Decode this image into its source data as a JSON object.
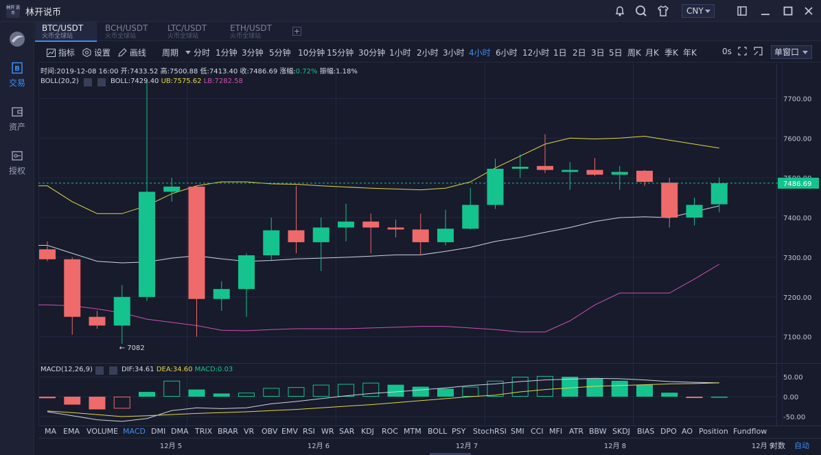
{
  "app": {
    "logo_text": "林开 说币",
    "title": "林开说币"
  },
  "titlebar": {
    "icons": [
      "bell-icon",
      "search-icon",
      "shirt-icon",
      "popout-icon",
      "minimize-icon",
      "maximize-icon",
      "close-icon"
    ],
    "currency": "CNY"
  },
  "sidebar": {
    "items": [
      {
        "name": "logo",
        "label": ""
      },
      {
        "name": "trade",
        "label": "交易",
        "icon": "B"
      },
      {
        "name": "assets",
        "label": "资产",
        "icon": "▭"
      },
      {
        "name": "auth",
        "label": "授权",
        "icon": "⚿"
      }
    ]
  },
  "pair_tabs": [
    {
      "pair": "BTC/USDT",
      "exchange": "火币全球站"
    },
    {
      "pair": "BCH/USDT",
      "exchange": "火币全球站"
    },
    {
      "pair": "LTC/USDT",
      "exchange": "火币全球站"
    },
    {
      "pair": "ETH/USDT",
      "exchange": "火币全球站"
    }
  ],
  "add_tab_label": "+",
  "toolbar": {
    "indicator": "指标",
    "settings": "设置",
    "draw": "画线",
    "period_label": "周期",
    "periods": [
      "分时",
      "1分钟",
      "3分钟",
      "5分钟",
      "10分钟",
      "15分钟",
      "30分钟",
      "1小时",
      "2小时",
      "3小时",
      "4小时",
      "6小时",
      "12小时",
      "1日",
      "2日",
      "3日",
      "5日",
      "周K",
      "月K",
      "季K",
      "年K"
    ],
    "active_period": "4小时",
    "countdown": "0s",
    "layout": "单窗口"
  },
  "ohlc_info": {
    "time_label": "时间:",
    "time": "2019-12-08 16:00",
    "open_label": "开:",
    "open": "7433.52",
    "high_label": "高:",
    "high": "7500.88",
    "low_label": "低:",
    "low": "7413.40",
    "close_label": "收:",
    "close": "7486.69",
    "change_label": "涨幅:",
    "change": "0.72%",
    "amplitude_label": "振幅:",
    "amplitude": "1.18%"
  },
  "boll_info": {
    "name": "BOLL(20,2)",
    "mid": "BOLL:7429.40",
    "ub": "UB:7575.62",
    "lb": "LB:7282.58"
  },
  "macd_info": {
    "name": "MACD(12,26,9)",
    "dif": "DIF:34.61",
    "dea": "DEA:34.60",
    "macd": "MACD:0.03"
  },
  "price_axis": [
    "7700.00",
    "7600.00",
    "7500.00",
    "7400.00",
    "7300.00",
    "7200.00",
    "7100.00"
  ],
  "current_price": "7486.69",
  "low_marker": "7082",
  "macd_axis": [
    "50.00",
    "0.00",
    "-50.00"
  ],
  "indicator_tabs": [
    "MA",
    "EMA",
    "VOLUME",
    "MACD",
    "DMI",
    "DMA",
    "TRIX",
    "BRAR",
    "VR",
    "OBV",
    "EMV",
    "RSI",
    "WR",
    "SAR",
    "KDJ",
    "ROC",
    "MTM",
    "BOLL",
    "PSY",
    "StochRSI",
    "SMI",
    "CCI",
    "MFI",
    "ATR",
    "BBW",
    "SKDJ",
    "BIAS",
    "DPO",
    "AO",
    "Position",
    "Fundflow"
  ],
  "active_indicator": "MACD",
  "date_axis": [
    "12月 5",
    "12月 6",
    "12月 7",
    "12月 8",
    "12月 9"
  ],
  "auto_label": "自动",
  "log_label": "对数",
  "colors": {
    "up": "#14c38e",
    "down": "#ef6a6a",
    "accent": "#3d8ef5",
    "ub": "#e6d84a",
    "mid": "#d0d3e3",
    "lb": "#d04fb8",
    "bg": "#171b2b"
  },
  "chart_data": {
    "type": "candlestick",
    "pair": "BTC/USDT",
    "period": "4小时",
    "ylim": [
      7050,
      7750
    ],
    "candles": [
      {
        "o": 7320,
        "h": 7340,
        "l": 7290,
        "c": 7295
      },
      {
        "o": 7295,
        "h": 7300,
        "l": 7105,
        "c": 7150
      },
      {
        "o": 7150,
        "h": 7165,
        "l": 7120,
        "c": 7128
      },
      {
        "o": 7128,
        "h": 7230,
        "l": 7082,
        "c": 7200
      },
      {
        "o": 7200,
        "h": 7745,
        "l": 7190,
        "c": 7465
      },
      {
        "o": 7465,
        "h": 7500,
        "l": 7440,
        "c": 7478
      },
      {
        "o": 7478,
        "h": 7480,
        "l": 7100,
        "c": 7195
      },
      {
        "o": 7195,
        "h": 7240,
        "l": 7165,
        "c": 7220
      },
      {
        "o": 7220,
        "h": 7310,
        "l": 7150,
        "c": 7305
      },
      {
        "o": 7305,
        "h": 7400,
        "l": 7290,
        "c": 7368
      },
      {
        "o": 7368,
        "h": 7480,
        "l": 7310,
        "c": 7338
      },
      {
        "o": 7338,
        "h": 7400,
        "l": 7265,
        "c": 7375
      },
      {
        "o": 7375,
        "h": 7435,
        "l": 7340,
        "c": 7390
      },
      {
        "o": 7390,
        "h": 7410,
        "l": 7310,
        "c": 7375
      },
      {
        "o": 7375,
        "h": 7395,
        "l": 7350,
        "c": 7370
      },
      {
        "o": 7370,
        "h": 7410,
        "l": 7305,
        "c": 7338
      },
      {
        "o": 7338,
        "h": 7420,
        "l": 7330,
        "c": 7372
      },
      {
        "o": 7372,
        "h": 7475,
        "l": 7370,
        "c": 7432
      },
      {
        "o": 7432,
        "h": 7548,
        "l": 7422,
        "c": 7523
      },
      {
        "o": 7523,
        "h": 7560,
        "l": 7500,
        "c": 7528
      },
      {
        "o": 7530,
        "h": 7610,
        "l": 7512,
        "c": 7520
      },
      {
        "o": 7515,
        "h": 7540,
        "l": 7470,
        "c": 7520
      },
      {
        "o": 7520,
        "h": 7550,
        "l": 7505,
        "c": 7508
      },
      {
        "o": 7508,
        "h": 7530,
        "l": 7470,
        "c": 7515
      },
      {
        "o": 7518,
        "h": 7520,
        "l": 7480,
        "c": 7490
      },
      {
        "o": 7488,
        "h": 7500,
        "l": 7375,
        "c": 7400
      },
      {
        "o": 7400,
        "h": 7450,
        "l": 7380,
        "c": 7432
      },
      {
        "o": 7433.52,
        "h": 7500.88,
        "l": 7413.4,
        "c": 7486.69
      }
    ],
    "boll_ub": [
      7480,
      7440,
      7410,
      7410,
      7430,
      7460,
      7480,
      7490,
      7490,
      7485,
      7484,
      7480,
      7477,
      7474,
      7472,
      7470,
      7474,
      7490,
      7525,
      7555,
      7585,
      7600,
      7598,
      7600,
      7605,
      7595,
      7585,
      7575
    ],
    "boll_mid": [
      7330,
      7310,
      7290,
      7286,
      7288,
      7298,
      7304,
      7296,
      7290,
      7292,
      7296,
      7298,
      7300,
      7303,
      7306,
      7306,
      7315,
      7325,
      7340,
      7350,
      7363,
      7375,
      7390,
      7400,
      7402,
      7400,
      7415,
      7429.4
    ],
    "boll_lb": [
      7180,
      7178,
      7170,
      7160,
      7144,
      7136,
      7128,
      7116,
      7115,
      7118,
      7120,
      7120,
      7120,
      7122,
      7124,
      7126,
      7126,
      7122,
      7118,
      7112,
      7112,
      7140,
      7180,
      7210,
      7210,
      7210,
      7245,
      7282.58
    ],
    "macd_hist": [
      -4,
      -20,
      -32,
      -30,
      12,
      40,
      18,
      8,
      10,
      22,
      24,
      30,
      32,
      35,
      30,
      25,
      20,
      25,
      40,
      50,
      52,
      50,
      45,
      40,
      30,
      10,
      -2,
      0.03
    ],
    "dif": [
      -38,
      -48,
      -58,
      -62,
      -55,
      -35,
      -28,
      -30,
      -28,
      -18,
      -12,
      -5,
      2,
      8,
      12,
      17,
      22,
      28,
      32,
      38,
      42,
      44,
      46,
      45,
      42,
      38,
      36,
      34.61
    ],
    "dea": [
      -36,
      -40,
      -45,
      -50,
      -48,
      -45,
      -42,
      -40,
      -38,
      -35,
      -32,
      -28,
      -24,
      -20,
      -15,
      -10,
      -5,
      0,
      4,
      12,
      18,
      22,
      26,
      28,
      30,
      32,
      33,
      34.6
    ],
    "macd_ylim": [
      -65,
      65
    ]
  }
}
